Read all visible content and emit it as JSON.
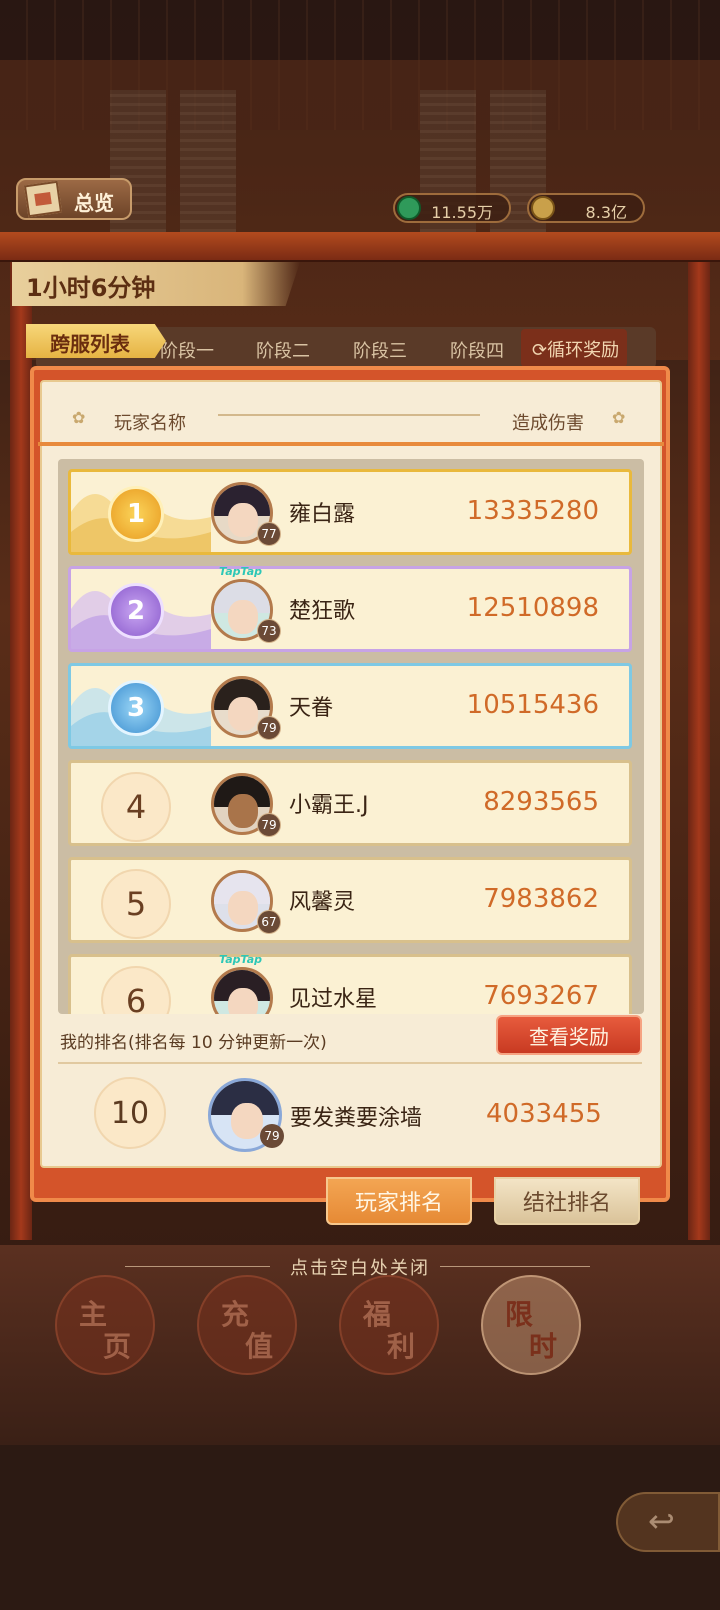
{
  "hud": {
    "overview_label": "总览",
    "currency1": "11.55万",
    "currency2": "8.3亿"
  },
  "timer": "1小时6分钟",
  "tabs": {
    "cross_server": "跨服列表",
    "stages": [
      "阶段一",
      "阶段二",
      "阶段三",
      "阶段四"
    ],
    "cycle_reward": "循环奖励"
  },
  "table_header": {
    "player_name": "玩家名称",
    "damage": "造成伤害"
  },
  "ranking": [
    {
      "rank": "1",
      "name": "雍白露",
      "level": "77",
      "damage": "13335280"
    },
    {
      "rank": "2",
      "name": "楚狂歌",
      "level": "73",
      "damage": "12510898",
      "badge": "TapTap"
    },
    {
      "rank": "3",
      "name": "天眷",
      "level": "79",
      "damage": "10515436"
    },
    {
      "rank": "4",
      "name": "小霸王.J",
      "level": "79",
      "damage": "8293565"
    },
    {
      "rank": "5",
      "name": "风馨灵",
      "level": "67",
      "damage": "7983862"
    },
    {
      "rank": "6",
      "name": "见过水星",
      "level": "",
      "damage": "7693267",
      "badge": "TapTap"
    }
  ],
  "my_rank": {
    "label": "我的排名(排名每 10 分钟更新一次)",
    "view_reward": "查看奖励",
    "rank": "10",
    "name": "要发粪要涂墙",
    "level": "79",
    "damage": "4033455"
  },
  "bottom_tabs": {
    "player_rank": "玩家排名",
    "guild_rank": "结社排名"
  },
  "close_hint": "点击空白处关闭",
  "nav": [
    {
      "c1": "主",
      "c2": "页"
    },
    {
      "c1": "充",
      "c2": "值"
    },
    {
      "c1": "福",
      "c2": "利"
    },
    {
      "c1": "限",
      "c2": "时"
    }
  ],
  "colors": {
    "gold_medal": "#f0b43a",
    "silver_purple": "#a678d8",
    "bronze_blue": "#5aa8de",
    "damage_text": "#d06a28"
  }
}
